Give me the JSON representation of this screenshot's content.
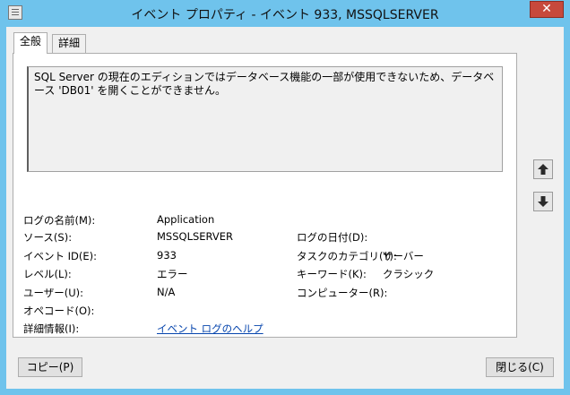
{
  "window": {
    "title": "イベント プロパティ - イベント 933, MSSQLSERVER",
    "close_label": "✕"
  },
  "tabs": [
    {
      "label": "全般"
    },
    {
      "label": "詳細"
    }
  ],
  "message": "SQL Server の現在のエディションではデータベース機能の一部が使用できないため、データベース 'DB01' を開くことができません。",
  "fields": {
    "log_name_label": "ログの名前(M):",
    "log_name_value": "Application",
    "source_label": "ソース(S):",
    "source_value": "MSSQLSERVER",
    "logged_label": "ログの日付(D):",
    "logged_value": "",
    "event_id_label": "イベント ID(E):",
    "event_id_value": "933",
    "task_category_label": "タスクのカテゴリ(Y):",
    "task_category_value": "サーバー",
    "level_label": "レベル(L):",
    "level_value": "エラー",
    "keywords_label": "キーワード(K):",
    "keywords_value": "クラシック",
    "user_label": "ユーザー(U):",
    "user_value": "N/A",
    "computer_label": "コンピューター(R):",
    "computer_value": "",
    "opcode_label": "オペコード(O):",
    "opcode_value": "",
    "more_info_label": "詳細情報(I):",
    "more_info_link": "イベント ログのヘルプ"
  },
  "buttons": {
    "copy": "コピー(P)",
    "close": "閉じる(C)"
  },
  "icons": {
    "up": "arrow-up-icon",
    "down": "arrow-down-icon"
  },
  "colors": {
    "titlebar": "#6fc3ec",
    "close": "#c7493c",
    "link": "#0645ad"
  }
}
